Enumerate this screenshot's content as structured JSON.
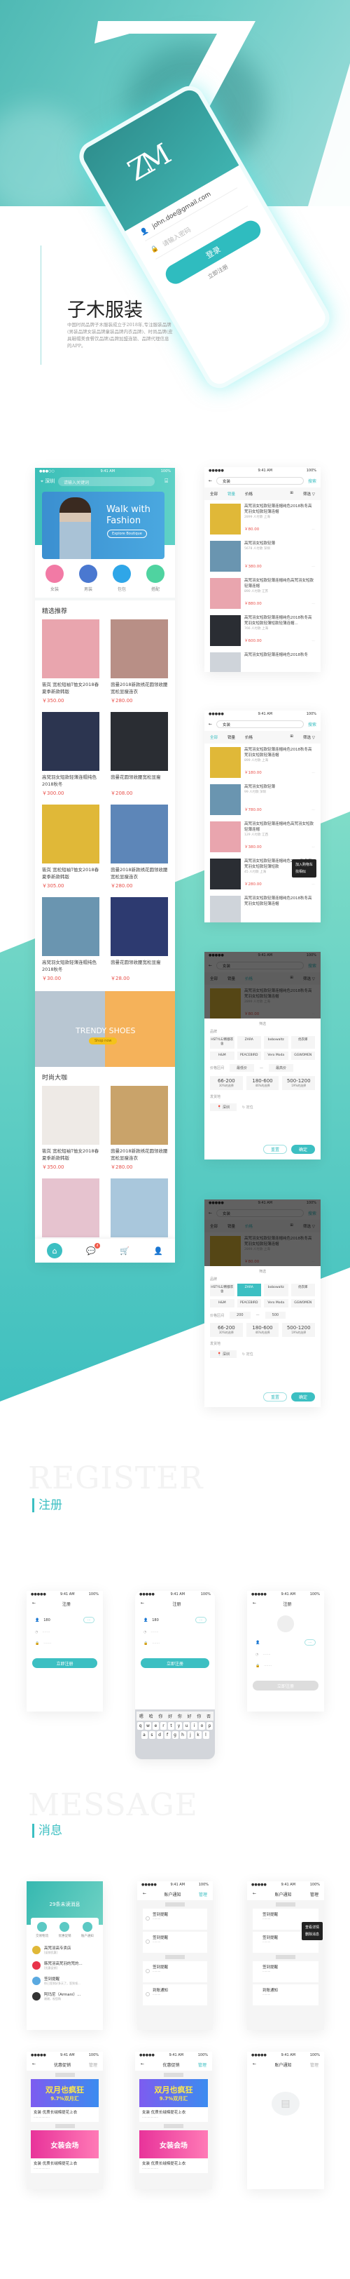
{
  "colors": {
    "accent": "#3cbfc2",
    "price": "#e8504a",
    "band_top": "#7fdcc8",
    "band_bottom": "#3fbfbf"
  },
  "hero": {
    "logo": "ZM",
    "email": "john.doe@gmail.com",
    "password_placeholder": "请输入密码",
    "login": "登录",
    "register": "立即注册"
  },
  "intro": {
    "title": "子木服装",
    "description": "中国时尚品牌子木服装成立于2018年,专注服装品牌(男装品牌女装品牌童装品牌内衣品牌)、时尚品牌(皮具鞋帽美食餐饮品牌)品牌加盟连锁、品牌代理信息的APP。"
  },
  "status": {
    "time": "9:41 AM",
    "battery": "100%"
  },
  "home": {
    "location": "深圳",
    "search_placeholder": "请输入关键词",
    "banner": {
      "title1": "Walk with",
      "title2": "Fashion",
      "button": "Explore Boutique"
    },
    "categories": [
      {
        "label": "女装",
        "color": "#f27aa5"
      },
      {
        "label": "男装",
        "color": "#4a78d0"
      },
      {
        "label": "包包",
        "color": "#2fa6e8"
      },
      {
        "label": "搭配",
        "color": "#4fd3a0"
      }
    ],
    "section1": "精选推荐",
    "products1": [
      {
        "name": "筱岚 宽松短袖T恤女2018春夏季新款韩版",
        "price": "￥350.00",
        "color": "#e9a5ae"
      },
      {
        "name": "茵曼2018新款绣花圆领收腰宽松显瘦连衣",
        "price": "￥280.00",
        "color": "#b88f86"
      },
      {
        "name": "高梵羽女短款轻薄连帽纯色2018秋冬",
        "price": "￥300.00",
        "color": "#2c3550"
      },
      {
        "name": "茵曼花圆领收腰宽松显瘦",
        "price": "￥208.00",
        "color": "#2a2d33"
      },
      {
        "name": "筱岚 宽松短袖T恤女2018春夏季新款韩版",
        "price": "￥305.00",
        "color": "#e0b838"
      },
      {
        "name": "茵曼2018新款绣花圆领收腰宽松显瘦连衣",
        "price": "￥280.00",
        "color": "#5d86b8"
      },
      {
        "name": "高梵羽女短款轻薄连帽纯色2018秋冬",
        "price": "￥30.00",
        "color": "#6a95b0"
      },
      {
        "name": "茵曼花圆领收腰宽松显瘦",
        "price": "￥28.00",
        "color": "#2d3a70"
      }
    ],
    "shoes": {
      "title": "TRENDY SHOES",
      "button": "Shop now"
    },
    "section2": "时尚大咖",
    "products2": [
      {
        "name": "筱岚 宽松短袖T恤女2018春夏季新款韩版",
        "price": "￥350.00",
        "color": "#eeeae6"
      },
      {
        "name": "茵曼2018新款绣花圆领收腰宽松显瘦连衣",
        "price": "￥280.00",
        "color": "#c9a36a"
      },
      {
        "name": "高梵羽女短款轻薄连",
        "price": "",
        "color": "#e6c3cf"
      },
      {
        "name": "茵曼花园领收腰宽松",
        "price": "",
        "color": "#a9c7dc"
      }
    ],
    "nav": {
      "home": "⌂",
      "messages": "💬",
      "cart": "🛒",
      "profile": "👤",
      "badge": "4"
    }
  },
  "search": {
    "back": "←",
    "query": "女装",
    "button": "搜索",
    "tabs": [
      "全部",
      "销量",
      "价格"
    ],
    "filter": "筛选",
    "list1": [
      {
        "title": "高梵羽女短款轻薄连帽纯色2018秋冬高梵羽女短款轻薄连帽",
        "meta": "2899 人付款 上海",
        "price": "￥80.00",
        "color": "#e0b838"
      },
      {
        "title": "高梵羽女短款轻薄",
        "meta": "5678 人付款 深圳",
        "price": "￥380.00",
        "color": "#6a95b0"
      },
      {
        "title": "高梵羽女短款轻薄连帽纯色高梵羽女短款轻薄连帽",
        "meta": "890 人付款 江苏",
        "price": "￥880.00",
        "color": "#e9a5ae"
      },
      {
        "title": "高梵羽女短款轻薄连帽纯色2018秋冬高梵羽女短款轻薄短款轻薄连帽...",
        "meta": "766 人付款 上海",
        "price": "￥600.00",
        "color": "#2a2d33"
      },
      {
        "title": "高梵羽女短款轻薄连帽纯色2018秋冬",
        "meta": "",
        "price": "",
        "color": "#cfd4da"
      }
    ],
    "list2": [
      {
        "title": "高梵羽女短款轻薄连帽纯色2018秋冬高梵羽女短款轻薄连帽",
        "meta": "899 人付款 上海",
        "price": "￥180.00",
        "color": "#e0b838"
      },
      {
        "title": "高梵羽女短款轻薄",
        "meta": "99 人付款 深圳",
        "price": "￥780.00",
        "color": "#6a95b0"
      },
      {
        "title": "高梵羽女短款轻薄连帽纯色高梵羽女短款轻薄连帽",
        "meta": "129 人付款 江西",
        "price": "￥380.00",
        "color": "#e9a5ae"
      },
      {
        "title": "高梵羽女短款轻薄连帽纯色2018秋冬高梵羽女短款轻薄短款",
        "meta": "45 人付款 上海",
        "price": "￥280.00",
        "color": "#2a2d33"
      },
      {
        "title": "高梵羽女短款轻薄连帽纯色2018秋冬高梵羽女短款轻薄连帽",
        "meta": "",
        "price": "",
        "color": "#cfd4da"
      }
    ],
    "tooltip": [
      "加入购物车",
      "找相似"
    ]
  },
  "filter": {
    "title": "筛选",
    "brand_label": "品牌",
    "brands": [
      "HSTYLE/韩都衣舍",
      "ZARA",
      "bobowaltz",
      "优衣库",
      "H&M",
      "PEACEBIRD",
      "Vero Moda",
      "GGWOMEN"
    ],
    "price_label": "价格区间",
    "min_placeholder": "最低价",
    "max_placeholder": "最高价",
    "min_value": "200",
    "max_value": "500",
    "ranges": [
      {
        "range": "66-200",
        "pct": "30%的选择"
      },
      {
        "range": "180-600",
        "pct": "46%的选择"
      },
      {
        "range": "500-1200",
        "pct": "19%的选择"
      }
    ],
    "origin_label": "发货地",
    "origin": "深圳",
    "locate": "定位",
    "reset": "重置",
    "confirm": "确定",
    "selected_brand": "ZARA"
  },
  "register_section": {
    "bg_word": "REGISTER",
    "title": "注册"
  },
  "register": {
    "title": "注册",
    "phone": "180",
    "submit": "立即注册",
    "keyboard_candidates": [
      "嗯",
      "哈",
      "你",
      "好",
      "你",
      "好",
      "你",
      "否"
    ],
    "keys_row1": [
      "q",
      "w",
      "e",
      "r",
      "t",
      "y",
      "u",
      "i",
      "o",
      "p"
    ],
    "keys_row2": [
      "a",
      "s",
      "d",
      "f",
      "g",
      "h",
      "j",
      "k",
      "l"
    ]
  },
  "message_section": {
    "bg_word": "MESSAGE",
    "title": "消息"
  },
  "messages": {
    "unread": "29条未读消息",
    "categories": [
      "交易物流",
      "优惠促销",
      "账户通知"
    ],
    "list": [
      {
        "name": "高梵羽高专卖店",
        "sub": "[促销优惠]"
      },
      {
        "name": "韩梵羽高梵羽的梵的...",
        "sub": "[优惠促销]"
      },
      {
        "name": "签到提醒",
        "sub": "你已签到好多天了，签到领..."
      },
      {
        "name": "阿玛尼（Armani）...",
        "sub": "谢谢，祝您购"
      }
    ],
    "account_title": "账户通知",
    "manage": "管理",
    "notices": [
      {
        "title": "签到提醒"
      },
      {
        "title": "签到提醒"
      },
      {
        "title": "签到提醒"
      },
      {
        "title": "到账通知"
      }
    ],
    "popup": [
      "查看详情",
      "删除消息"
    ],
    "promo_title": "优惠促销",
    "promos": [
      {
        "banner": "双月也疯狂",
        "sub": "9.7%双月汇",
        "title": "女装 优质长绒棉提花上衣"
      },
      {
        "banner": "女装会场",
        "sub": "",
        "title": "女装 优质长绒棉提花上衣"
      }
    ]
  }
}
